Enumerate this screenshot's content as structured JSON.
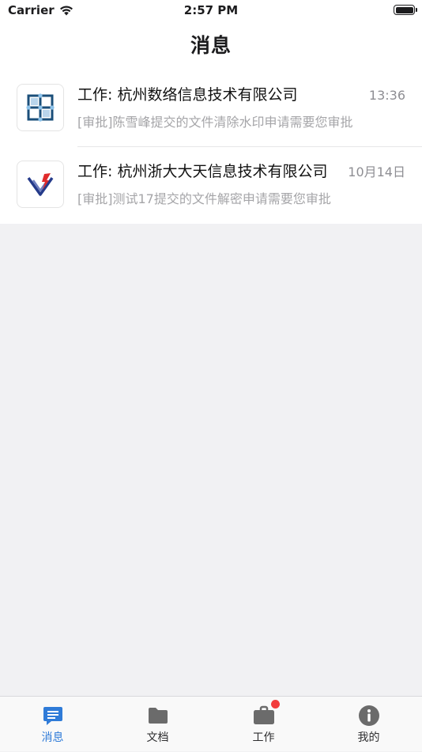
{
  "status_bar": {
    "carrier": "Carrier",
    "time": "2:57 PM"
  },
  "header": {
    "title": "消息"
  },
  "messages": [
    {
      "title": "工作: 杭州数络信息技术有限公司",
      "time": "13:36",
      "preview": "[审批]陈雪峰提交的文件清除水印申请需要您审批",
      "avatar_icon": "grid-logo-icon"
    },
    {
      "title": "工作: 杭州浙大大天信息技术有限公司",
      "time": "10月14日",
      "preview": "[审批]测试17提交的文件解密申请需要您审批",
      "avatar_icon": "triangle-logo-icon"
    }
  ],
  "tabbar": {
    "items": [
      {
        "label": "消息",
        "icon": "message-icon",
        "active": true
      },
      {
        "label": "文档",
        "icon": "folder-icon",
        "active": false
      },
      {
        "label": "工作",
        "icon": "briefcase-icon",
        "active": false,
        "badge": true
      },
      {
        "label": "我的",
        "icon": "info-icon",
        "active": false
      }
    ]
  },
  "colors": {
    "accent": "#2f7bd8",
    "badge": "#f23c3c",
    "icon_gray": "#6b6b6b",
    "background": "#f1f1f3"
  }
}
